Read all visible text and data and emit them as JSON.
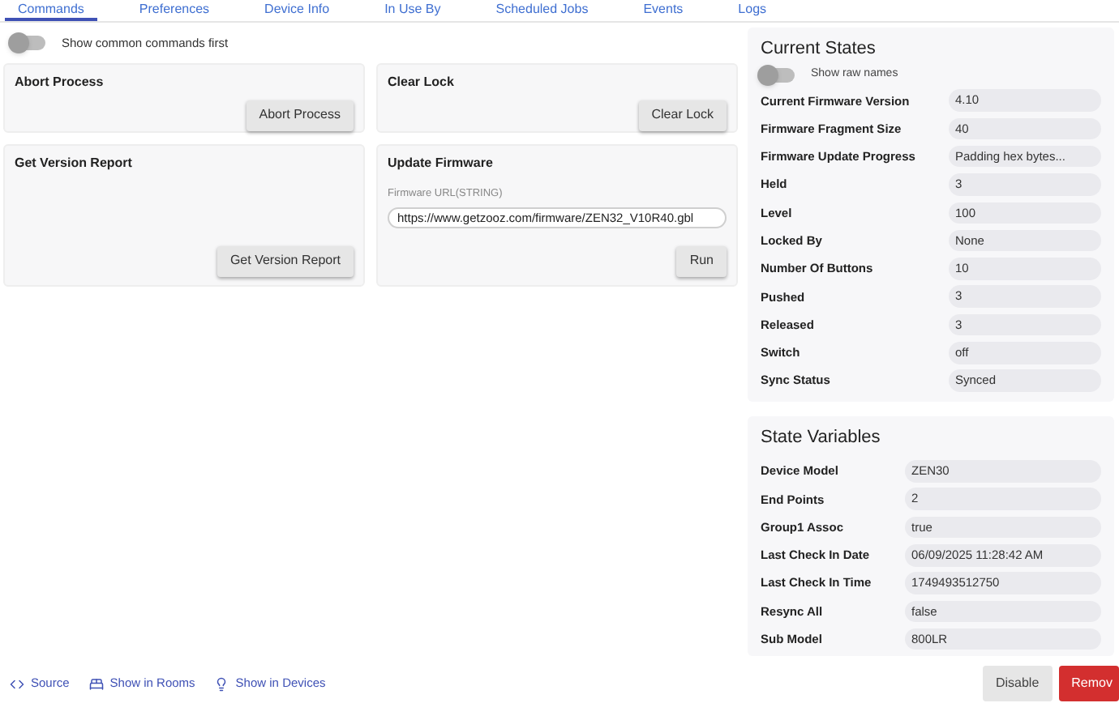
{
  "tabs": [
    {
      "label": "Commands",
      "selected": true
    },
    {
      "label": "Preferences",
      "selected": false
    },
    {
      "label": "Device Info",
      "selected": false
    },
    {
      "label": "In Use By",
      "selected": false
    },
    {
      "label": "Scheduled Jobs",
      "selected": false
    },
    {
      "label": "Events",
      "selected": false
    },
    {
      "label": "Logs",
      "selected": false
    }
  ],
  "common_toggle": {
    "label": "Show common commands first",
    "on": false
  },
  "commands": [
    {
      "title": "Abort Process",
      "button": "Abort Process"
    },
    {
      "title": "Clear Lock",
      "button": "Clear Lock"
    },
    {
      "title": "Get Version Report",
      "button": "Get Version Report"
    },
    {
      "title": "Update Firmware",
      "field_label": "Firmware URL(STRING)",
      "value": "https://www.getzooz.com/firmware/ZEN32_V10R40.gbl",
      "button": "Run"
    }
  ],
  "current_states": {
    "title": "Current States",
    "raw_toggle": {
      "label": "Show raw names",
      "on": false
    },
    "rows": [
      {
        "name": "Current Firmware Version",
        "value": "4.10"
      },
      {
        "name": "Firmware Fragment Size",
        "value": "40"
      },
      {
        "name": "Firmware Update Progress",
        "value": "Padding hex bytes..."
      },
      {
        "name": "Held",
        "value": "3"
      },
      {
        "name": "Level",
        "value": "100"
      },
      {
        "name": "Locked By",
        "value": "None"
      },
      {
        "name": "Number Of Buttons",
        "value": "10"
      },
      {
        "name": "Pushed",
        "value": "3"
      },
      {
        "name": "Released",
        "value": "3"
      },
      {
        "name": "Switch",
        "value": "off"
      },
      {
        "name": "Sync Status",
        "value": "Synced"
      }
    ]
  },
  "state_variables": {
    "title": "State Variables",
    "rows": [
      {
        "name": "Device Model",
        "value": "ZEN30"
      },
      {
        "name": "End Points",
        "value": "2"
      },
      {
        "name": "Group1 Assoc",
        "value": "true"
      },
      {
        "name": "Last Check In Date",
        "value": "06/09/2025 11:28:42 AM"
      },
      {
        "name": "Last Check In Time",
        "value": "1749493512750"
      },
      {
        "name": "Resync All",
        "value": "false"
      },
      {
        "name": "Sub Model",
        "value": "800LR"
      }
    ]
  },
  "footer_links": [
    {
      "kind": "code",
      "label": "Source"
    },
    {
      "kind": "rooms",
      "label": "Show in Rooms"
    },
    {
      "kind": "bulb",
      "label": "Show in Devices"
    }
  ],
  "footer_buttons": [
    {
      "kind": "plain",
      "label": "Disable"
    },
    {
      "kind": "danger",
      "label": "Remov"
    }
  ]
}
